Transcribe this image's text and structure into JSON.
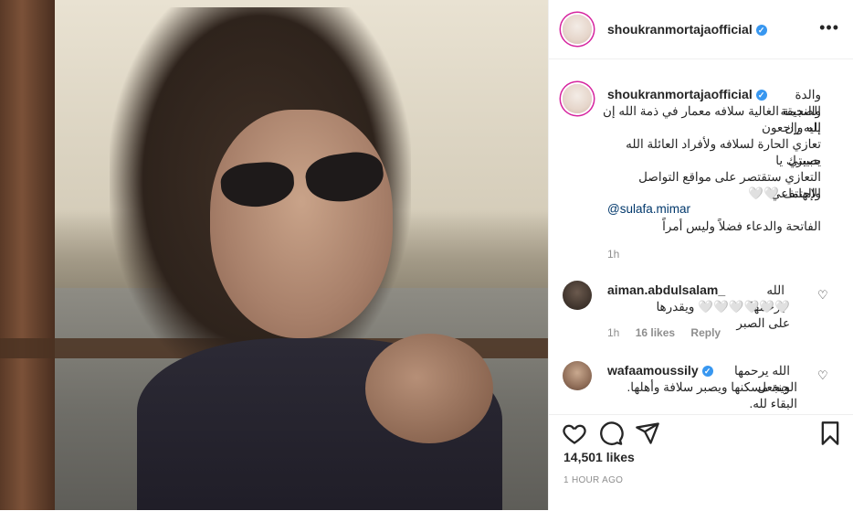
{
  "post": {
    "username": "shoukranmortaja official",
    "username_display": "shoukranmortajaofficial",
    "more_label": "•••"
  },
  "caption": {
    "lead": "والدة الصديقة",
    "lines": [
      "والنجمة الغالية سلافه معمار في ذمة الله إن لله وإن",
      "إليه راجعون",
      "تعازي الحارة لسلافه ولأفراد العائلة الله يصبرك يا",
      "حبيبتي",
      "التعازي ستقتصر على مواقع التواصل الإجتماعي",
      "والهاتف 🤍🤍"
    ],
    "mention": "@sulafa.mimar",
    "last_line": "الفاتحة والدعاء فضلاً وليس أمراً",
    "time": "1h"
  },
  "comments": [
    {
      "username": "aiman.abdulsalam_",
      "line1": "الله يرحمها",
      "line2": "🤍🤍🤍🤍🤍🤍 ويقدرها على الصبر",
      "time": "1h",
      "likes": "16 likes",
      "reply": "Reply"
    },
    {
      "username": "wafaamoussily",
      "line1": "الله يرحمها ويجعل",
      "line2": "الجنة مسكنها ويصبر سلافة وأهلها. البقاء لله."
    }
  ],
  "stats": {
    "likes": "14,501 likes",
    "posted": "1 HOUR AGO"
  }
}
